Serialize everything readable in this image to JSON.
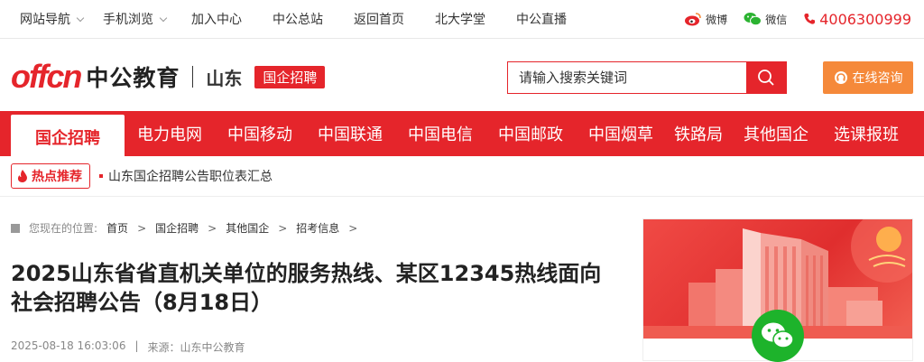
{
  "topbar": {
    "items": [
      "网站导航",
      "手机浏览",
      "加入中心",
      "中公总站",
      "返回首页",
      "北大学堂",
      "中公直播"
    ],
    "weibo": "微博",
    "weixin": "微信",
    "phone": "4006300999"
  },
  "header": {
    "logo_text": "offcn",
    "brand": "中公教育",
    "province": "山东",
    "tag": "国企招聘",
    "search_placeholder": "请输入搜索关键词",
    "consult": "在线咨询"
  },
  "mainnav": {
    "items": [
      "国企招聘",
      "电力电网",
      "中国移动",
      "中国联通",
      "中国电信",
      "中国邮政",
      "中国烟草",
      "铁路局",
      "其他国企",
      "选课报班"
    ]
  },
  "hot": {
    "badge": "热点推荐",
    "link": "山东国企招聘公告职位表汇总"
  },
  "breadcrumb": {
    "label": "您现在的位置:",
    "items": [
      "首页",
      "国企招聘",
      "其他国企",
      "招考信息"
    ]
  },
  "article": {
    "title_line1": "2025山东省省直机关单位的服务热线、某区12345热线面向",
    "title_line2": "社会招聘公告（8月18日）",
    "date": "2025-08-18 16:03:06",
    "source": "来源：山东中公教育"
  },
  "colors": {
    "accent": "#e5252b",
    "consult": "#f5893a",
    "wechat": "#1db32b"
  }
}
